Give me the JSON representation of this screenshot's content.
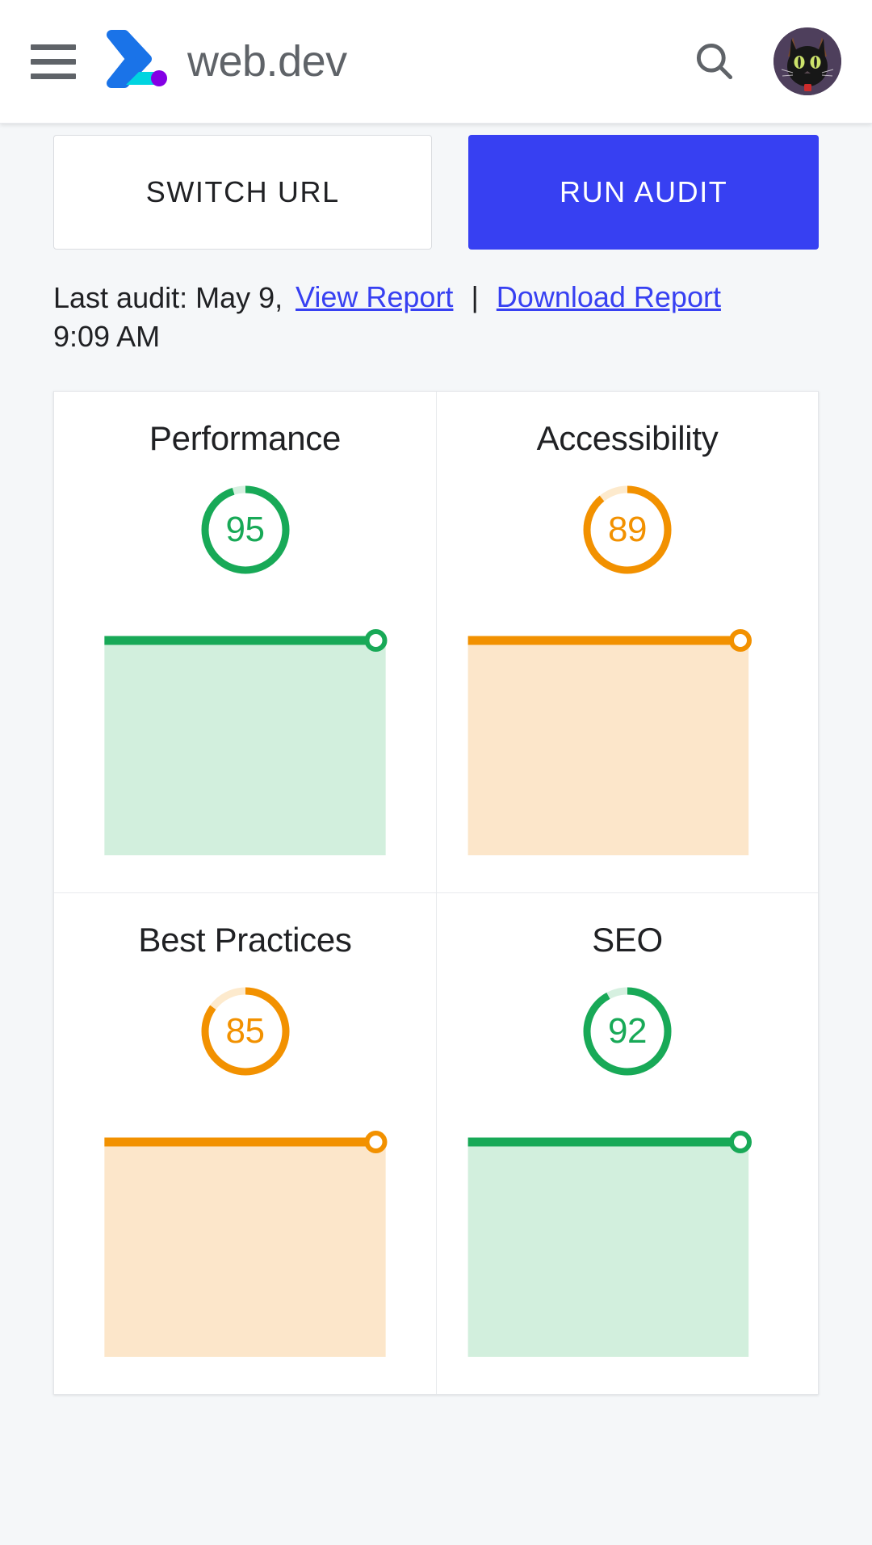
{
  "header": {
    "menu_icon": "hamburger-menu-icon",
    "logo_icon": "webdev-logo-icon",
    "brand": "web.dev",
    "search_icon": "search-icon",
    "avatar_icon": "cat-avatar-icon"
  },
  "toolbar": {
    "switch_url_label": "SWITCH URL",
    "run_audit_label": "RUN AUDIT"
  },
  "audit_meta": {
    "last_audit": "Last audit: May 9, 9:09 AM",
    "view_report_label": "View Report",
    "separator": "|",
    "download_report_label": "Download Report"
  },
  "colors": {
    "brand_blue": "#3740f2",
    "link_blue": "#3740f2",
    "pass_green": "#18a957",
    "pass_green_track": "#d6f0e0",
    "pass_green_fill": "#d2efdd",
    "average_orange": "#f29100",
    "average_orange_track": "#fdeacd",
    "average_orange_fill": "#fce6ca",
    "text_primary": "#202124",
    "text_secondary": "#5f6368",
    "page_background": "#f5f7f9",
    "card_background": "#ffffff"
  },
  "chart_data": [
    {
      "type": "line",
      "title": "Performance",
      "score": 95,
      "status": "pass",
      "color": "#18a957",
      "fill": "#d2efdd",
      "x": [
        0,
        1,
        2,
        3,
        4,
        5,
        6
      ],
      "values": [
        95,
        95,
        95,
        95,
        95,
        95,
        95
      ],
      "ylim": [
        0,
        100
      ],
      "grid": false,
      "legend": "none",
      "marker_at": "last"
    },
    {
      "type": "line",
      "title": "Accessibility",
      "score": 89,
      "status": "average",
      "color": "#f29100",
      "fill": "#fce6ca",
      "x": [
        0,
        1,
        2,
        3,
        4,
        5,
        6
      ],
      "values": [
        89,
        89,
        89,
        89,
        89,
        89,
        89
      ],
      "ylim": [
        0,
        100
      ],
      "grid": false,
      "legend": "none",
      "marker_at": "last"
    },
    {
      "type": "line",
      "title": "Best Practices",
      "score": 85,
      "status": "average",
      "color": "#f29100",
      "fill": "#fce6ca",
      "x": [
        0,
        1,
        2,
        3,
        4,
        5,
        6
      ],
      "values": [
        85,
        85,
        85,
        85,
        85,
        85,
        85
      ],
      "ylim": [
        0,
        100
      ],
      "grid": false,
      "legend": "none",
      "marker_at": "last"
    },
    {
      "type": "line",
      "title": "SEO",
      "score": 92,
      "status": "pass",
      "color": "#18a957",
      "fill": "#d2efdd",
      "x": [
        0,
        1,
        2,
        3,
        4,
        5,
        6
      ],
      "values": [
        92,
        92,
        92,
        92,
        92,
        92,
        92
      ],
      "ylim": [
        0,
        100
      ],
      "grid": false,
      "legend": "none",
      "marker_at": "last"
    }
  ],
  "cards": [
    {
      "title": "Performance",
      "score": "95"
    },
    {
      "title": "Accessibility",
      "score": "89"
    },
    {
      "title": "Best Practices",
      "score": "85"
    },
    {
      "title": "SEO",
      "score": "92"
    }
  ]
}
